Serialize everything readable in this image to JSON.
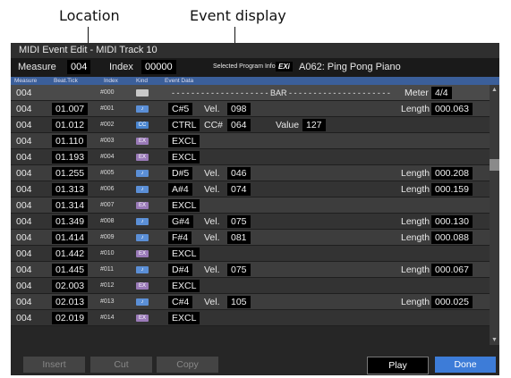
{
  "callouts": {
    "location": "Location",
    "event_display": "Event display"
  },
  "window": {
    "title": "MIDI Event Edit - MIDI Track 10"
  },
  "header": {
    "measure_label": "Measure",
    "measure_value": "004",
    "index_label": "Index",
    "index_value": "00000",
    "program_label": "Selected Program Info.",
    "program_badge": "EXi",
    "program_name": "A062: Ping Pong Piano"
  },
  "columns": {
    "measure": "Measure",
    "beat_tick": "Beat.Tick",
    "index": "Index",
    "kind": "Kind",
    "event_data": "Event Data"
  },
  "bar_row": {
    "measure": "004",
    "index": "#000",
    "dashes": "- - - - - - - - - - - - - - - - - - - - BAR - - - - - - - - - - - - - - - - - - - - -",
    "meter_label": "Meter",
    "meter_value": "4/4"
  },
  "rows": [
    {
      "measure": "004",
      "tick": "01.007",
      "index": "#001",
      "kind": "note",
      "kind_glyph": "♪",
      "note": "C#5",
      "vel_label": "Vel.",
      "vel": "098",
      "len_label": "Length",
      "len": "000.063"
    },
    {
      "measure": "004",
      "tick": "01.012",
      "index": "#002",
      "kind": "cc",
      "kind_glyph": "CC",
      "note": "CTRL",
      "vel_label": "CC#",
      "vel": "064",
      "value_label": "Value",
      "value": "127"
    },
    {
      "measure": "004",
      "tick": "01.110",
      "index": "#003",
      "kind": "excl",
      "kind_glyph": "EX",
      "note": "EXCL"
    },
    {
      "measure": "004",
      "tick": "01.193",
      "index": "#004",
      "kind": "excl",
      "kind_glyph": "EX",
      "note": "EXCL"
    },
    {
      "measure": "004",
      "tick": "01.255",
      "index": "#005",
      "kind": "note",
      "kind_glyph": "♪",
      "note": "D#5",
      "vel_label": "Vel.",
      "vel": "046",
      "len_label": "Length",
      "len": "000.208"
    },
    {
      "measure": "004",
      "tick": "01.313",
      "index": "#006",
      "kind": "note",
      "kind_glyph": "♪",
      "note": "A#4",
      "vel_label": "Vel.",
      "vel": "074",
      "len_label": "Length",
      "len": "000.159"
    },
    {
      "measure": "004",
      "tick": "01.314",
      "index": "#007",
      "kind": "excl",
      "kind_glyph": "EX",
      "note": "EXCL"
    },
    {
      "measure": "004",
      "tick": "01.349",
      "index": "#008",
      "kind": "note",
      "kind_glyph": "♪",
      "note": "G#4",
      "vel_label": "Vel.",
      "vel": "075",
      "len_label": "Length",
      "len": "000.130"
    },
    {
      "measure": "004",
      "tick": "01.414",
      "index": "#009",
      "kind": "note",
      "kind_glyph": "♪",
      "note": "F#4",
      "vel_label": "Vel.",
      "vel": "081",
      "len_label": "Length",
      "len": "000.088"
    },
    {
      "measure": "004",
      "tick": "01.442",
      "index": "#010",
      "kind": "excl",
      "kind_glyph": "EX",
      "note": "EXCL"
    },
    {
      "measure": "004",
      "tick": "01.445",
      "index": "#011",
      "kind": "note",
      "kind_glyph": "♪",
      "note": "D#4",
      "vel_label": "Vel.",
      "vel": "075",
      "len_label": "Length",
      "len": "000.067"
    },
    {
      "measure": "004",
      "tick": "02.003",
      "index": "#012",
      "kind": "excl",
      "kind_glyph": "EX",
      "note": "EXCL"
    },
    {
      "measure": "004",
      "tick": "02.013",
      "index": "#013",
      "kind": "note",
      "kind_glyph": "♪",
      "note": "C#4",
      "vel_label": "Vel.",
      "vel": "105",
      "len_label": "Length",
      "len": "000.025"
    },
    {
      "measure": "004",
      "tick": "02.019",
      "index": "#014",
      "kind": "excl",
      "kind_glyph": "EX",
      "note": "EXCL"
    }
  ],
  "buttons": {
    "insert": "Insert",
    "cut": "Cut",
    "copy": "Copy",
    "play": "Play",
    "done": "Done"
  },
  "scroll": {
    "up_glyph": "▲",
    "down_glyph": "▼"
  }
}
